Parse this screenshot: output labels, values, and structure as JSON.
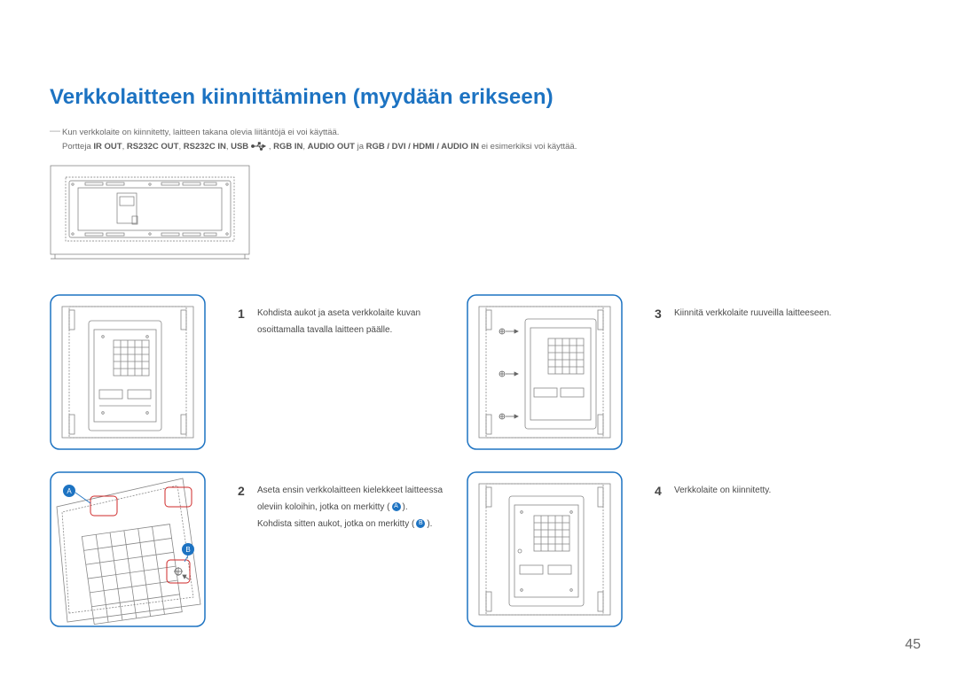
{
  "title": "Verkkolaitteen kiinnittäminen (myydään erikseen)",
  "note": {
    "line1": "Kun verkkolaite on kiinnitetty, laitteen takana olevia liitäntöjä ei voi käyttää.",
    "line2_prefix": "Portteja ",
    "ports": {
      "p1": "IR OUT",
      "p2": "RS232C OUT",
      "p3": "RS232C IN",
      "p4": "USB",
      "p5": "RGB IN",
      "p6": "AUDIO OUT",
      "p7": "RGB / DVI / HDMI / AUDIO IN"
    },
    "sep": ", ",
    "line2_mid": " ja ",
    "line2_suffix": " ei esimerkiksi voi käyttää."
  },
  "steps": {
    "s1": {
      "num": "1",
      "text": "Kohdista aukot ja aseta verkkolaite kuvan osoittamalla tavalla laitteen päälle."
    },
    "s2": {
      "num": "2",
      "t1": "Aseta ensin verkkolaitteen kielekkeet laitteessa oleviin koloihin, jotka on merkitty (",
      "badgeA": "A",
      "t2": "). Kohdista sitten aukot, jotka on merkitty (",
      "badgeB": "B",
      "t3": ")."
    },
    "s3": {
      "num": "3",
      "text": "Kiinnitä verkkolaite ruuveilla laitteeseen."
    },
    "s4": {
      "num": "4",
      "text": "Verkkolaite on kiinnitetty."
    }
  },
  "diagram_labels": {
    "A": "A",
    "B": "B"
  },
  "page_number": "45"
}
